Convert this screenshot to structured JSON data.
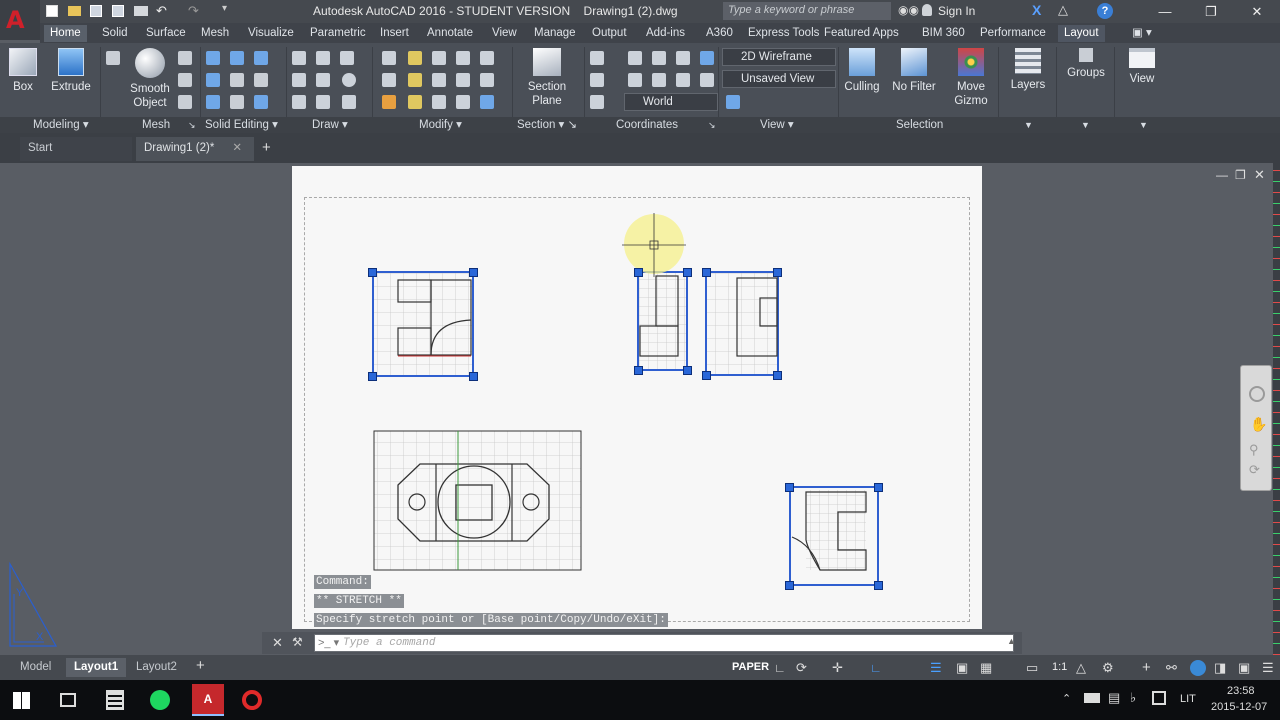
{
  "window": {
    "title": "Autodesk AutoCAD 2016 - STUDENT VERSION    Drawing1 (2).dwg",
    "search_placeholder": "Type a keyword or phrase",
    "sign_in": "Sign In"
  },
  "ribbon_tabs": [
    "Home",
    "Solid",
    "Surface",
    "Mesh",
    "Visualize",
    "Parametric",
    "Insert",
    "Annotate",
    "View",
    "Manage",
    "Output",
    "Add-ins",
    "A360",
    "Express Tools",
    "Featured Apps",
    "BIM 360",
    "Performance",
    "Layout"
  ],
  "ribbon": {
    "box": "Box",
    "extrude": "Extrude",
    "smooth_object_1": "Smooth",
    "smooth_object_2": "Object",
    "section_plane_1": "Section",
    "section_plane_2": "Plane",
    "visual_style": "2D Wireframe",
    "saved_view": "Unsaved View",
    "ucs": "World",
    "culling": "Culling",
    "no_filter": "No Filter",
    "move_gizmo_1": "Move",
    "move_gizmo_2": "Gizmo",
    "layers": "Layers",
    "groups": "Groups",
    "view": "View"
  },
  "panel_titles": {
    "modeling": "Modeling",
    "mesh": "Mesh",
    "solid_editing": "Solid Editing",
    "draw": "Draw",
    "modify": "Modify",
    "section": "Section",
    "coordinates": "Coordinates",
    "view": "View",
    "selection": "Selection"
  },
  "doc_tabs": {
    "start": "Start",
    "drawing": "Drawing1 (2)*"
  },
  "command": {
    "history": [
      "Command:",
      "** STRETCH **",
      "Specify stretch point or [Base point/Copy/Undo/eXit]:"
    ],
    "placeholder": "Type a command"
  },
  "layout_tabs": [
    "Model",
    "Layout1",
    "Layout2"
  ],
  "status": {
    "paper": "PAPER",
    "scale": "1:1"
  },
  "taskbar": {
    "lang": "LIT",
    "time": "23:58",
    "date": "2015-12-07"
  },
  "colors": {
    "viewport_border": "#2f5fd0",
    "grip": "#2a67d8",
    "accent_red": "#c8202a"
  }
}
